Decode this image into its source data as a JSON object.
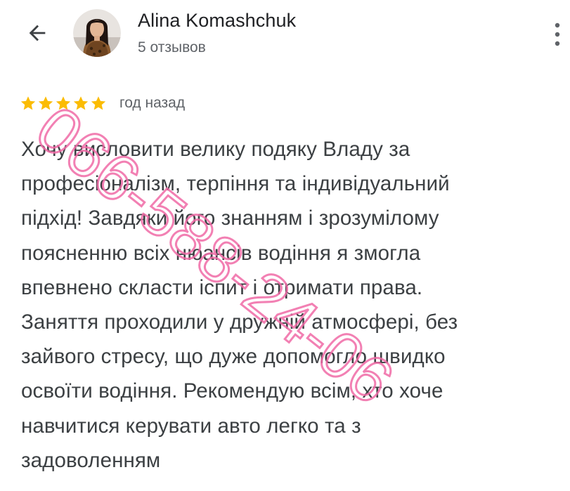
{
  "header": {
    "user_name": "Alina Komashchuk",
    "review_count": "5 отзывов",
    "back_icon": "arrow-left-icon",
    "more_icon": "more-vert-icon"
  },
  "review": {
    "rating": 5,
    "rating_max": 5,
    "date": "год назад",
    "star_color": "#fbbc04",
    "lines": [
      "Хочу висловити велику подяку Владу за",
      "професіоналізм, терпіння та індивідуальний",
      "підхід! Завдяки його знанням і зрозумілому",
      "поясненню всіх нюансів водіння я змогла",
      "впевнено скласти іспит і отримати права.",
      "Заняття проходили у дружній атмосфері, без",
      "зайвого стресу, що дуже допомогло швидко",
      "освоїти водіння. Рекомендую всім, хто хоче",
      "навчитися керувати авто легко та з",
      "задоволенням"
    ]
  },
  "watermark": {
    "text": "066-588-24-06",
    "color": "#f06aa6"
  },
  "colors": {
    "text_primary": "#202124",
    "text_secondary": "#5f6368",
    "review_text": "#3c4043"
  }
}
